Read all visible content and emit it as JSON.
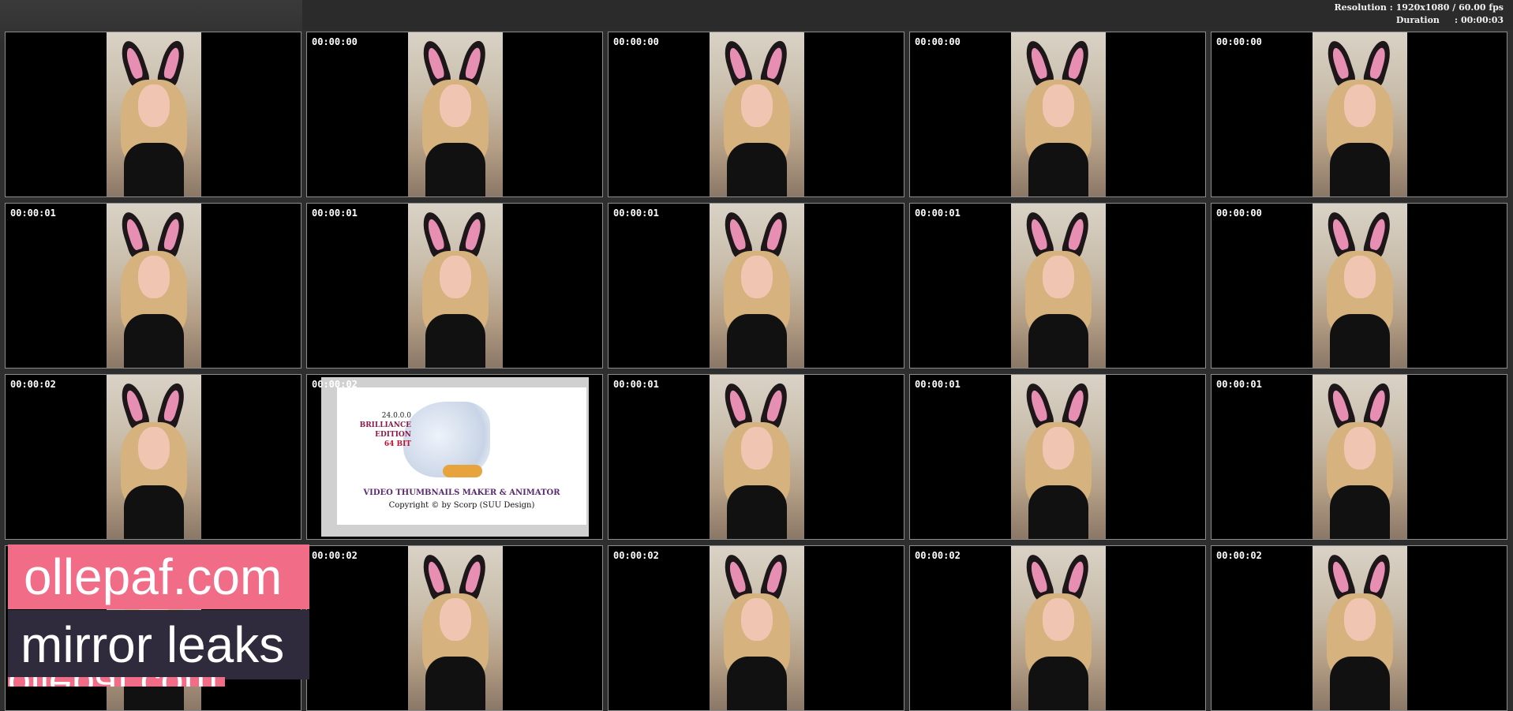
{
  "meta": {
    "resolution_label": "Resolution",
    "resolution_value": "1920x1080 / 60.00 fps",
    "duration_label": "Duration",
    "duration_value": "00:00:03"
  },
  "tiles": [
    {
      "ts": ""
    },
    {
      "ts": "00:00:00"
    },
    {
      "ts": "00:00:00"
    },
    {
      "ts": "00:00:00"
    },
    {
      "ts": "00:00:00"
    },
    {
      "ts": "00:00:01"
    },
    {
      "ts": "00:00:01"
    },
    {
      "ts": "00:00:01"
    },
    {
      "ts": "00:00:01"
    },
    {
      "ts": "00:00:00"
    },
    {
      "ts": "00:00:02"
    },
    {
      "ts": "00:00:02"
    },
    {
      "ts": "00:00:01"
    },
    {
      "ts": "00:00:01"
    },
    {
      "ts": "00:00:01"
    },
    {
      "ts": ""
    },
    {
      "ts": "00:00:02"
    },
    {
      "ts": "00:00:02"
    },
    {
      "ts": "00:00:02"
    },
    {
      "ts": "00:00:02"
    }
  ],
  "splash": {
    "version": "24.0.0.0",
    "edition_1": "BRILLIANCE",
    "edition_2": "EDITION",
    "bits": "64 BIT",
    "title": "VIDEO THUMBNAILS MAKER & ANIMATOR",
    "copyright": "Copyright © by Scorp (SUU Design)"
  },
  "watermark": {
    "line1": "ollepaf.com",
    "line2": "mirror leaks",
    "line3": "ollepaf.com"
  }
}
